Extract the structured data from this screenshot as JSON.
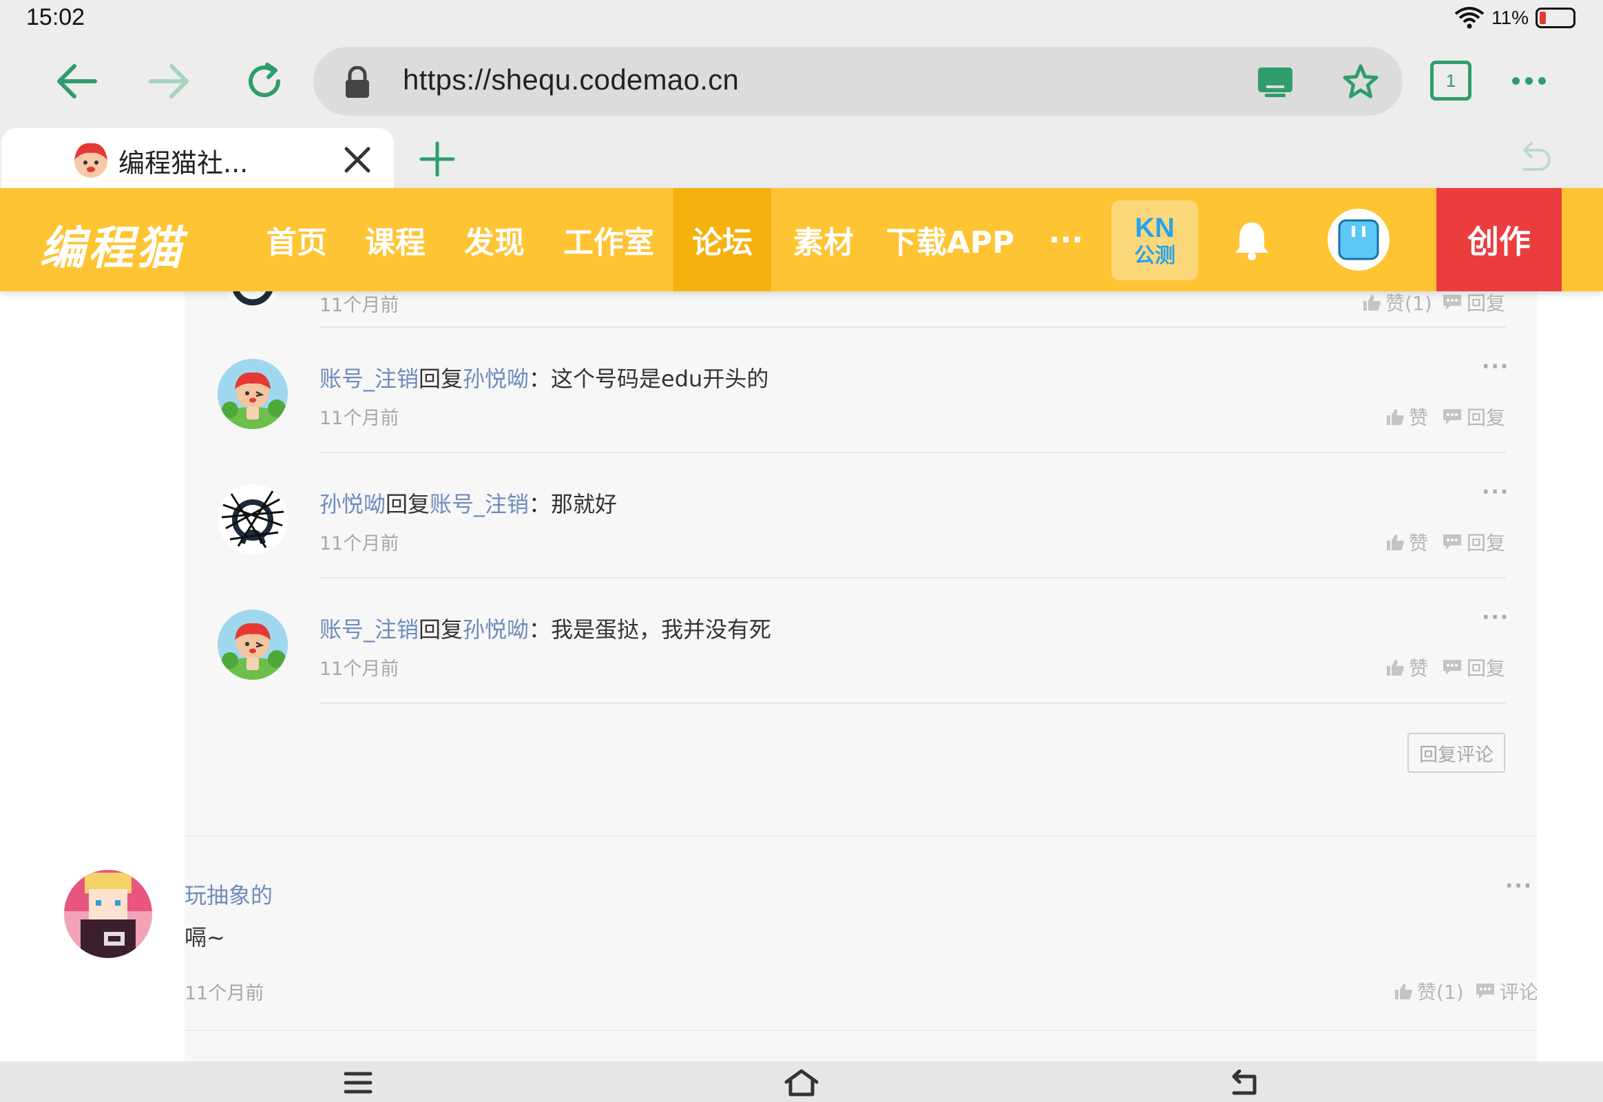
{
  "status_bar": {
    "time": "15:02",
    "battery": "11%"
  },
  "browser": {
    "url": "https://shequ.codemao.cn",
    "tab_count": "1",
    "tab_title": "编程猫社...",
    "colors": {
      "accent": "#2f9d6b"
    }
  },
  "site": {
    "logo": "编程猫",
    "nav": [
      "首页",
      "课程",
      "发现",
      "工作室",
      "论坛",
      "素材",
      "下载APP"
    ],
    "nav_more": "···",
    "kn_badge": {
      "top": "KN",
      "bottom": "公测"
    },
    "create_label": "创作",
    "colors": {
      "header": "#fec433",
      "active_nav": "#f6b10f",
      "create": "#eb3d3d"
    }
  },
  "replies": {
    "partial_first": {
      "time": "11个月前",
      "like": "赞(1)",
      "reply": "回复"
    },
    "items": [
      {
        "from": "账号_注销",
        "verb": "回复",
        "to": "孙悦呦",
        "text": "：这个号码是edu开头的",
        "time": "11个月前",
        "like": "赞",
        "reply": "回复",
        "avatar": "cat-mascot"
      },
      {
        "from": "孙悦呦",
        "verb": "回复",
        "to": "账号_注销",
        "text": "：那就好",
        "time": "11个月前",
        "like": "赞",
        "reply": "回复",
        "avatar": "scribbled"
      },
      {
        "from": "账号_注销",
        "verb": "回复",
        "to": "孙悦呦",
        "text": "：我是蛋挞，我并没有死",
        "time": "11个月前",
        "like": "赞",
        "reply": "回复",
        "avatar": "cat-mascot"
      }
    ],
    "reply_comment_button": "回复评论"
  },
  "comment": {
    "author": "玩抽象的",
    "text": "嗝~",
    "time": "11个月前",
    "like": "赞(1)",
    "comment": "评论"
  }
}
